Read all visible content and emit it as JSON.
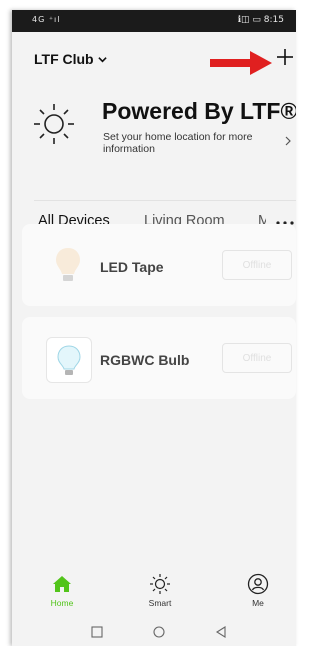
{
  "status": {
    "left": "4G ⁺ıl",
    "right": "ℹ◫ ▭ 8:15"
  },
  "header": {
    "home_name": "LTF Club"
  },
  "weather": {
    "title": "Powered By LTF®",
    "subtitle": "Set your home location for more information"
  },
  "tabs": [
    {
      "label": "All Devices"
    },
    {
      "label": "Living Room"
    },
    {
      "label": "M"
    }
  ],
  "devices": [
    {
      "name": "LED Tape",
      "status": "Offline"
    },
    {
      "name": "RGBWC Bulb",
      "status": "Offline"
    }
  ],
  "tabbar": [
    {
      "label": "Home",
      "icon": "home-icon"
    },
    {
      "label": "Smart",
      "icon": "sun-icon"
    },
    {
      "label": "Me",
      "icon": "user-icon"
    }
  ],
  "navbar": {
    "icons": [
      "square-icon",
      "circle-icon",
      "triangle-back-icon"
    ]
  },
  "colors": {
    "accent": "#52c41a",
    "arrow": "#e02020"
  }
}
